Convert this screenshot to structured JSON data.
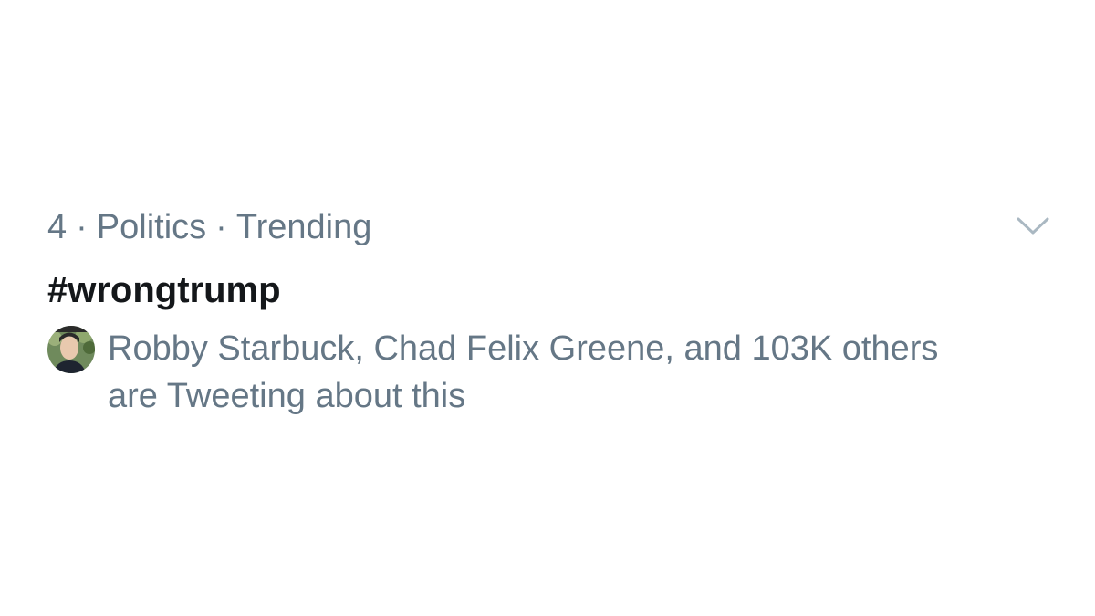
{
  "trend": {
    "rank": "4",
    "separator": "·",
    "category": "Politics",
    "status": "Trending",
    "hashtag": "#wrongtrump",
    "context_line1": "Robby Starbuck, Chad Felix Greene, and 103K others",
    "context_line2": "are Tweeting about this",
    "menu_icon": "chevron-down-icon",
    "avatar_icon": "user-avatar"
  },
  "colors": {
    "secondary_text": "#657786",
    "primary_text": "#14171a",
    "chevron": "#aab8c2"
  }
}
